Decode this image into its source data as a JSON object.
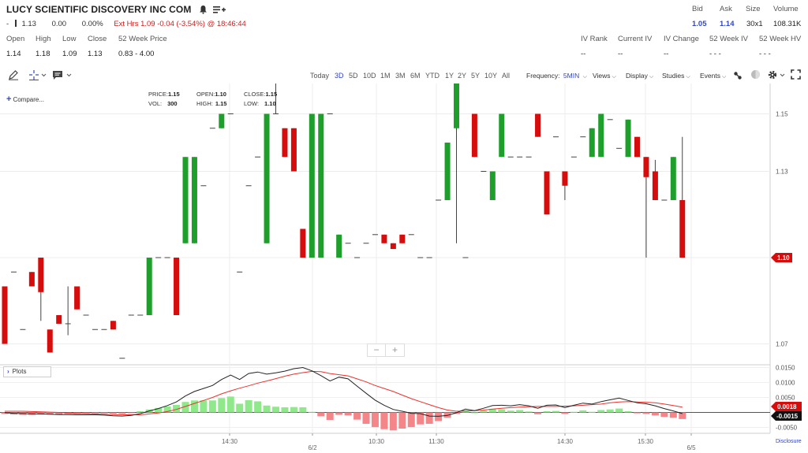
{
  "header": {
    "title": "LUCY SCIENTIFIC DISCOVERY INC COM",
    "dash": "-",
    "last_price": "1.13",
    "change": "0.00",
    "change_pct": "0.00%",
    "ext_hours": "Ext Hrs 1.09 -0.04 (-3.54%) @ 18:46:44"
  },
  "quote": {
    "bid_label": "Bid",
    "bid": "1.05",
    "ask_label": "Ask",
    "ask": "1.14",
    "size_label": "Size",
    "size": "30x1",
    "volume_label": "Volume",
    "volume": "108.31K"
  },
  "stats": {
    "labels": [
      "Open",
      "High",
      "Low",
      "Close",
      "52 Week Price"
    ],
    "values": [
      "1.14",
      "1.18",
      "1.09",
      "1.13",
      "0.83 - 4.00"
    ]
  },
  "iv": {
    "labels": [
      "IV Rank",
      "Current IV",
      "IV Change",
      "52 Week IV",
      "52 Week HV"
    ],
    "values": [
      "--",
      "--",
      "--",
      "- - -",
      "- - -"
    ]
  },
  "toolbar": {
    "ranges": [
      "Today",
      "3D",
      "5D",
      "10D",
      "1M",
      "3M",
      "6M",
      "YTD",
      "1Y",
      "2Y",
      "5Y",
      "10Y",
      "All"
    ],
    "active_range": "3D",
    "frequency_label": "Frequency:",
    "frequency_value": "5MIN",
    "views": "Views",
    "display": "Display",
    "studies": "Studies",
    "events": "Events"
  },
  "chart_overlay": {
    "compare": "Compare...",
    "price_label": "PRICE:",
    "price": "1.15",
    "open_label": "OPEN:",
    "open": "1.10",
    "close_label": "CLOSE:",
    "close": "1.15",
    "vol_label": "VOL:",
    "vol": "300",
    "high_label": "HIGH:",
    "high": "1.15",
    "low_label": "LOW:",
    "low": "1.10",
    "plots": "Plots",
    "zoom_out": "−",
    "zoom_in": "+",
    "disclosure": "Disclosure"
  },
  "colors": {
    "up": "#1e9e2a",
    "down": "#d60d0d",
    "accent": "#2f45c8",
    "macd_line": "#222222",
    "signal_line": "#e8342f",
    "hist_up": "#8fe88a",
    "hist_down": "#f4868a"
  },
  "chart_data": [
    {
      "type": "candlestick",
      "interval": "5MIN",
      "y_ticks": [
        "1.15",
        "1.13",
        "1.10",
        "1.07"
      ],
      "ylim": [
        1.05,
        1.18
      ],
      "last_price_label": "1.10",
      "x_ticks": [
        "14:30",
        "6/2",
        "10:30",
        "11:30",
        "14:30",
        "15:30",
        "6/5"
      ],
      "candles": [
        {
          "o": 1.09,
          "h": 1.09,
          "l": 1.07,
          "c": 1.07
        },
        {
          "o": 1.095,
          "h": 1.095,
          "l": 1.095,
          "c": 1.095
        },
        {
          "o": 1.075,
          "h": 1.075,
          "l": 1.075,
          "c": 1.075
        },
        {
          "o": 1.095,
          "h": 1.095,
          "l": 1.09,
          "c": 1.09
        },
        {
          "o": 1.1,
          "h": 1.1,
          "l": 1.078,
          "c": 1.088
        },
        {
          "o": 1.075,
          "h": 1.075,
          "l": 1.067,
          "c": 1.067
        },
        {
          "o": 1.08,
          "h": 1.08,
          "l": 1.077,
          "c": 1.077
        },
        {
          "o": 1.077,
          "h": 1.09,
          "l": 1.073,
          "c": 1.077
        },
        {
          "o": 1.09,
          "h": 1.09,
          "l": 1.082,
          "c": 1.082
        },
        {
          "o": 1.08,
          "h": 1.08,
          "l": 1.08,
          "c": 1.08
        },
        {
          "o": 1.075,
          "h": 1.075,
          "l": 1.075,
          "c": 1.075
        },
        {
          "o": 1.075,
          "h": 1.075,
          "l": 1.075,
          "c": 1.075
        },
        {
          "o": 1.078,
          "h": 1.078,
          "l": 1.075,
          "c": 1.075
        },
        {
          "o": 1.065,
          "h": 1.065,
          "l": 1.065,
          "c": 1.065
        },
        {
          "o": 1.08,
          "h": 1.08,
          "l": 1.08,
          "c": 1.08
        },
        {
          "o": 1.08,
          "h": 1.08,
          "l": 1.08,
          "c": 1.08
        },
        {
          "o": 1.08,
          "h": 1.1,
          "l": 1.08,
          "c": 1.1
        },
        {
          "o": 1.1,
          "h": 1.1,
          "l": 1.1,
          "c": 1.1
        },
        {
          "o": 1.1,
          "h": 1.1,
          "l": 1.1,
          "c": 1.1
        },
        {
          "o": 1.1,
          "h": 1.1,
          "l": 1.08,
          "c": 1.08
        },
        {
          "o": 1.105,
          "h": 1.135,
          "l": 1.105,
          "c": 1.135
        },
        {
          "o": 1.105,
          "h": 1.135,
          "l": 1.105,
          "c": 1.135
        },
        {
          "o": 1.125,
          "h": 1.125,
          "l": 1.125,
          "c": 1.125
        },
        {
          "o": 1.145,
          "h": 1.145,
          "l": 1.145,
          "c": 1.145
        },
        {
          "o": 1.145,
          "h": 1.15,
          "l": 1.145,
          "c": 1.15
        },
        {
          "o": 1.15,
          "h": 1.15,
          "l": 1.15,
          "c": 1.15
        },
        {
          "o": 1.095,
          "h": 1.095,
          "l": 1.095,
          "c": 1.095
        },
        {
          "o": 1.125,
          "h": 1.125,
          "l": 1.125,
          "c": 1.125
        },
        {
          "o": 1.135,
          "h": 1.135,
          "l": 1.135,
          "c": 1.135
        },
        {
          "o": 1.105,
          "h": 1.15,
          "l": 1.105,
          "c": 1.15
        },
        {
          "o": 1.15,
          "h": 1.17,
          "l": 1.15,
          "c": 1.15
        },
        {
          "o": 1.145,
          "h": 1.145,
          "l": 1.135,
          "c": 1.135
        },
        {
          "o": 1.145,
          "h": 1.145,
          "l": 1.13,
          "c": 1.13
        },
        {
          "o": 1.11,
          "h": 1.11,
          "l": 1.1,
          "c": 1.1
        },
        {
          "o": 1.1,
          "h": 1.15,
          "l": 1.1,
          "c": 1.15
        },
        {
          "o": 1.1,
          "h": 1.15,
          "l": 1.1,
          "c": 1.15
        },
        {
          "o": 1.15,
          "h": 1.15,
          "l": 1.15,
          "c": 1.15
        },
        {
          "o": 1.1,
          "h": 1.108,
          "l": 1.1,
          "c": 1.108
        },
        {
          "o": 1.105,
          "h": 1.105,
          "l": 1.105,
          "c": 1.105
        },
        {
          "o": 1.1,
          "h": 1.1,
          "l": 1.1,
          "c": 1.1
        },
        {
          "o": 1.105,
          "h": 1.105,
          "l": 1.105,
          "c": 1.105
        },
        {
          "o": 1.108,
          "h": 1.108,
          "l": 1.108,
          "c": 1.108
        },
        {
          "o": 1.108,
          "h": 1.108,
          "l": 1.105,
          "c": 1.105
        },
        {
          "o": 1.105,
          "h": 1.105,
          "l": 1.103,
          "c": 1.103
        },
        {
          "o": 1.108,
          "h": 1.108,
          "l": 1.105,
          "c": 1.105
        },
        {
          "o": 1.108,
          "h": 1.108,
          "l": 1.108,
          "c": 1.108
        },
        {
          "o": 1.1,
          "h": 1.1,
          "l": 1.1,
          "c": 1.1
        },
        {
          "o": 1.1,
          "h": 1.1,
          "l": 1.1,
          "c": 1.1
        },
        {
          "o": 1.12,
          "h": 1.12,
          "l": 1.12,
          "c": 1.12
        },
        {
          "o": 1.12,
          "h": 1.14,
          "l": 1.12,
          "c": 1.14
        },
        {
          "o": 1.145,
          "h": 1.165,
          "l": 1.105,
          "c": 1.165
        },
        {
          "o": 1.1,
          "h": 1.1,
          "l": 1.1,
          "c": 1.1
        },
        {
          "o": 1.15,
          "h": 1.15,
          "l": 1.135,
          "c": 1.135
        },
        {
          "o": 1.13,
          "h": 1.13,
          "l": 1.13,
          "c": 1.13
        },
        {
          "o": 1.12,
          "h": 1.13,
          "l": 1.12,
          "c": 1.13
        },
        {
          "o": 1.135,
          "h": 1.15,
          "l": 1.135,
          "c": 1.15
        },
        {
          "o": 1.135,
          "h": 1.135,
          "l": 1.135,
          "c": 1.135
        },
        {
          "o": 1.135,
          "h": 1.135,
          "l": 1.135,
          "c": 1.135
        },
        {
          "o": 1.135,
          "h": 1.135,
          "l": 1.135,
          "c": 1.135
        },
        {
          "o": 1.15,
          "h": 1.15,
          "l": 1.142,
          "c": 1.142
        },
        {
          "o": 1.13,
          "h": 1.13,
          "l": 1.115,
          "c": 1.115
        },
        {
          "o": 1.142,
          "h": 1.142,
          "l": 1.142,
          "c": 1.142
        },
        {
          "o": 1.13,
          "h": 1.13,
          "l": 1.12,
          "c": 1.125
        },
        {
          "o": 1.135,
          "h": 1.135,
          "l": 1.135,
          "c": 1.135
        },
        {
          "o": 1.142,
          "h": 1.142,
          "l": 1.142,
          "c": 1.142
        },
        {
          "o": 1.135,
          "h": 1.145,
          "l": 1.135,
          "c": 1.145
        },
        {
          "o": 1.135,
          "h": 1.15,
          "l": 1.135,
          "c": 1.15
        },
        {
          "o": 1.148,
          "h": 1.148,
          "l": 1.148,
          "c": 1.148
        },
        {
          "o": 1.138,
          "h": 1.138,
          "l": 1.138,
          "c": 1.138
        },
        {
          "o": 1.135,
          "h": 1.148,
          "l": 1.135,
          "c": 1.148
        },
        {
          "o": 1.142,
          "h": 1.142,
          "l": 1.135,
          "c": 1.135
        },
        {
          "o": 1.135,
          "h": 1.135,
          "l": 1.1,
          "c": 1.128
        },
        {
          "o": 1.13,
          "h": 1.134,
          "l": 1.12,
          "c": 1.12
        },
        {
          "o": 1.12,
          "h": 1.12,
          "l": 1.12,
          "c": 1.12
        },
        {
          "o": 1.12,
          "h": 1.135,
          "l": 1.12,
          "c": 1.135
        },
        {
          "o": 1.12,
          "h": 1.142,
          "l": 1.1,
          "c": 1.1
        }
      ]
    },
    {
      "type": "macd",
      "y_ticks": [
        "0.0150",
        "0.0100",
        "0.0050",
        "-0.0050"
      ],
      "ylim": [
        -0.0075,
        0.0175
      ],
      "labels": [
        "0.0018",
        "-0.0015"
      ],
      "macd": [
        -0.0001,
        -0.0003,
        -0.0004,
        -0.0005,
        -0.0005,
        -0.0006,
        -0.0007,
        -0.0007,
        -0.0008,
        -0.0008,
        -0.0008,
        -0.0009,
        -0.0011,
        -0.0012,
        -0.001,
        -0.0004,
        0.0005,
        0.0013,
        0.0023,
        0.0035,
        0.0055,
        0.007,
        0.008,
        0.009,
        0.011,
        0.0125,
        0.011,
        0.013,
        0.0135,
        0.0128,
        0.0132,
        0.0138,
        0.0146,
        0.015,
        0.0139,
        0.0123,
        0.0105,
        0.0118,
        0.0112,
        0.0088,
        0.0064,
        0.0041,
        0.0024,
        0.001,
        0.0004,
        -0.0003,
        -0.0004,
        -0.0012,
        -0.0013,
        -0.001,
        -0.0001,
        0.0011,
        0.0006,
        0.0014,
        0.0023,
        0.0024,
        0.0022,
        0.0026,
        0.0022,
        0.0014,
        0.0024,
        0.0025,
        0.0016,
        0.0024,
        0.0031,
        0.0028,
        0.0036,
        0.0042,
        0.0048,
        0.004,
        0.0032,
        0.0029,
        0.0022,
        0.0013,
        0.0005,
        -0.0004
      ],
      "signal": [
        0.0004,
        0.0004,
        0.0004,
        0.0003,
        0.0002,
        0.0001,
        0.0,
        -0.0002,
        -0.0003,
        -0.0004,
        -0.0005,
        -0.0006,
        -0.0007,
        -0.0008,
        -0.0008,
        -0.0008,
        -0.0005,
        -0.0002,
        0.0003,
        0.001,
        0.002,
        0.003,
        0.004,
        0.005,
        0.0062,
        0.0072,
        0.0081,
        0.0089,
        0.0098,
        0.0105,
        0.0113,
        0.0121,
        0.0128,
        0.0133,
        0.0137,
        0.0136,
        0.013,
        0.0126,
        0.0122,
        0.0112,
        0.0102,
        0.009,
        0.008,
        0.007,
        0.0058,
        0.0046,
        0.0036,
        0.0026,
        0.0016,
        0.0008,
        0.0004,
        0.0005,
        0.0006,
        0.0008,
        0.0011,
        0.0014,
        0.0016,
        0.0018,
        0.0019,
        0.002,
        0.002,
        0.002,
        0.0021,
        0.0022,
        0.0024,
        0.0026,
        0.0028,
        0.0032,
        0.0035,
        0.0036,
        0.0035,
        0.0034,
        0.0032,
        0.0028,
        0.0023,
        0.0018
      ],
      "histogram": [
        -0.0005,
        -0.0007,
        -0.0008,
        -0.0008,
        -0.0007,
        -0.0007,
        -0.0007,
        -0.0005,
        -0.0005,
        -0.0004,
        -0.0003,
        -0.0003,
        -0.0004,
        -0.0004,
        -0.0002,
        0.0004,
        0.001,
        0.0015,
        0.002,
        0.0025,
        0.0035,
        0.004,
        0.004,
        0.004,
        0.0048,
        0.0053,
        0.0029,
        0.0041,
        0.0037,
        0.0023,
        0.0019,
        0.0017,
        0.0018,
        0.0017,
        0.0002,
        -0.0013,
        -0.0025,
        -0.0008,
        -0.001,
        -0.0024,
        -0.0038,
        -0.0049,
        -0.0056,
        -0.006,
        -0.0054,
        -0.0049,
        -0.004,
        -0.0038,
        -0.0029,
        -0.0018,
        -0.0005,
        0.0006,
        0.0,
        0.0006,
        0.0012,
        0.001,
        0.0006,
        0.0008,
        0.0003,
        -0.0006,
        0.0004,
        0.0005,
        -0.0005,
        0.0002,
        0.0007,
        0.0002,
        0.0008,
        0.001,
        0.0013,
        0.0004,
        -0.0003,
        -0.0005,
        -0.001,
        -0.0015,
        -0.0018,
        -0.0022
      ]
    }
  ]
}
